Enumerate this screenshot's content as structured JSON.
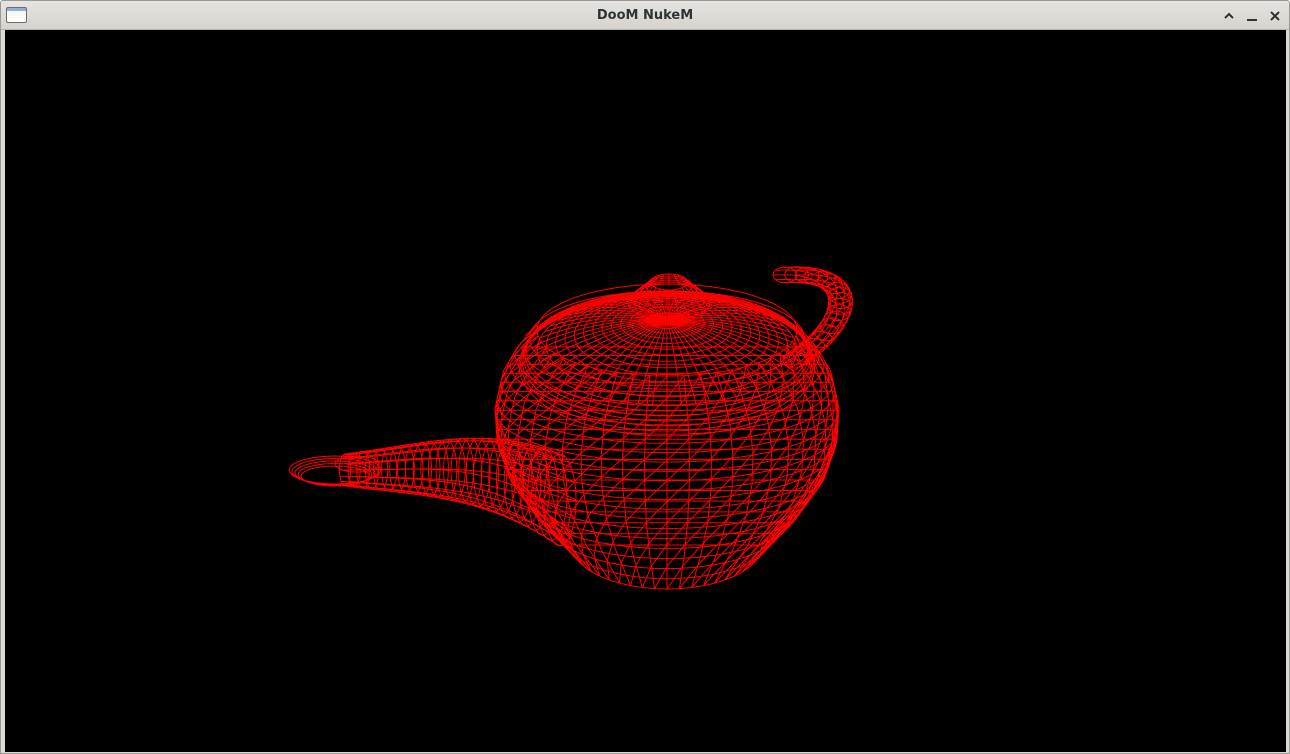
{
  "window": {
    "title": "DooM NukeM",
    "controls": {
      "maximize_icon": "chevron-up-icon",
      "minimize_icon": "minimize-icon",
      "close_icon": "close-icon"
    }
  },
  "viewport": {
    "background": "#000000",
    "render_mode": "wireframe",
    "model": "teapot",
    "wire_color": "#ff0000"
  }
}
